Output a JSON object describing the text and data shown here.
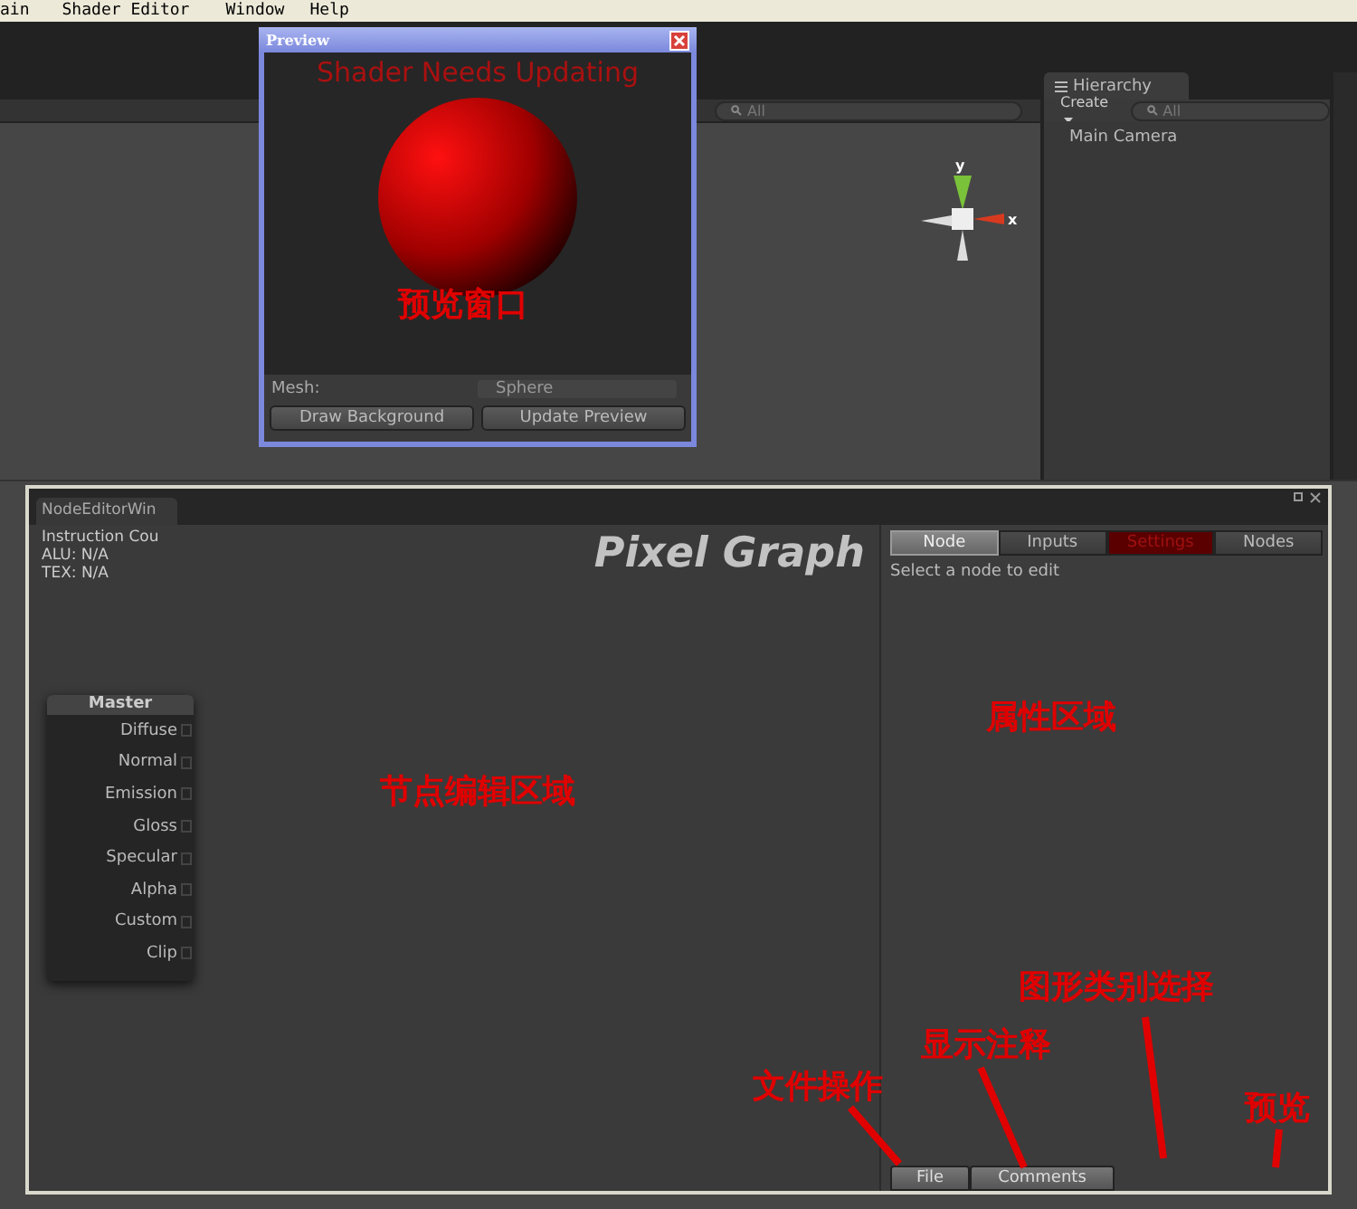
{
  "menu_bar": {
    "items": [
      "ain",
      "Shader Editor",
      "Window",
      "Help"
    ]
  },
  "scene_view": {
    "search": {
      "placeholder": "All"
    },
    "gizmo": {
      "y_label": "y",
      "x_label": "x"
    }
  },
  "hierarchy": {
    "tab": "Hierarchy",
    "create": "Create",
    "search": {
      "placeholder": "All"
    },
    "items": [
      "Main Camera"
    ]
  },
  "preview_window": {
    "title": "Preview",
    "status": "Shader Needs Updating",
    "mesh_label": "Mesh:",
    "mesh_value": "Sphere",
    "buttons": [
      "Draw Background",
      "Update Preview"
    ]
  },
  "node_editor": {
    "tab": "NodeEditorWin",
    "stats": [
      "Instruction Cou",
      "ALU: N/A",
      "TEX: N/A"
    ],
    "title": "Pixel Graph",
    "master_node": {
      "title": "Master",
      "inputs": [
        "Diffuse",
        "Normal",
        "Emission",
        "Gloss",
        "Specular",
        "Alpha",
        "Custom",
        "Clip"
      ]
    },
    "inspector": {
      "tabs": [
        {
          "label": "Node",
          "selected": true,
          "highlighted": false
        },
        {
          "label": "Inputs",
          "selected": false,
          "highlighted": false
        },
        {
          "label": "Settings",
          "selected": false,
          "highlighted": true
        },
        {
          "label": "Nodes",
          "selected": false,
          "highlighted": false
        }
      ],
      "hint": "Select a node to edit"
    },
    "bottom_buttons": [
      "File",
      "Comments"
    ]
  },
  "annotations": [
    "预览窗口",
    "节点编辑区域",
    "属性区域",
    "图形类别选择",
    "显示注释",
    "文件操作",
    "预览"
  ]
}
